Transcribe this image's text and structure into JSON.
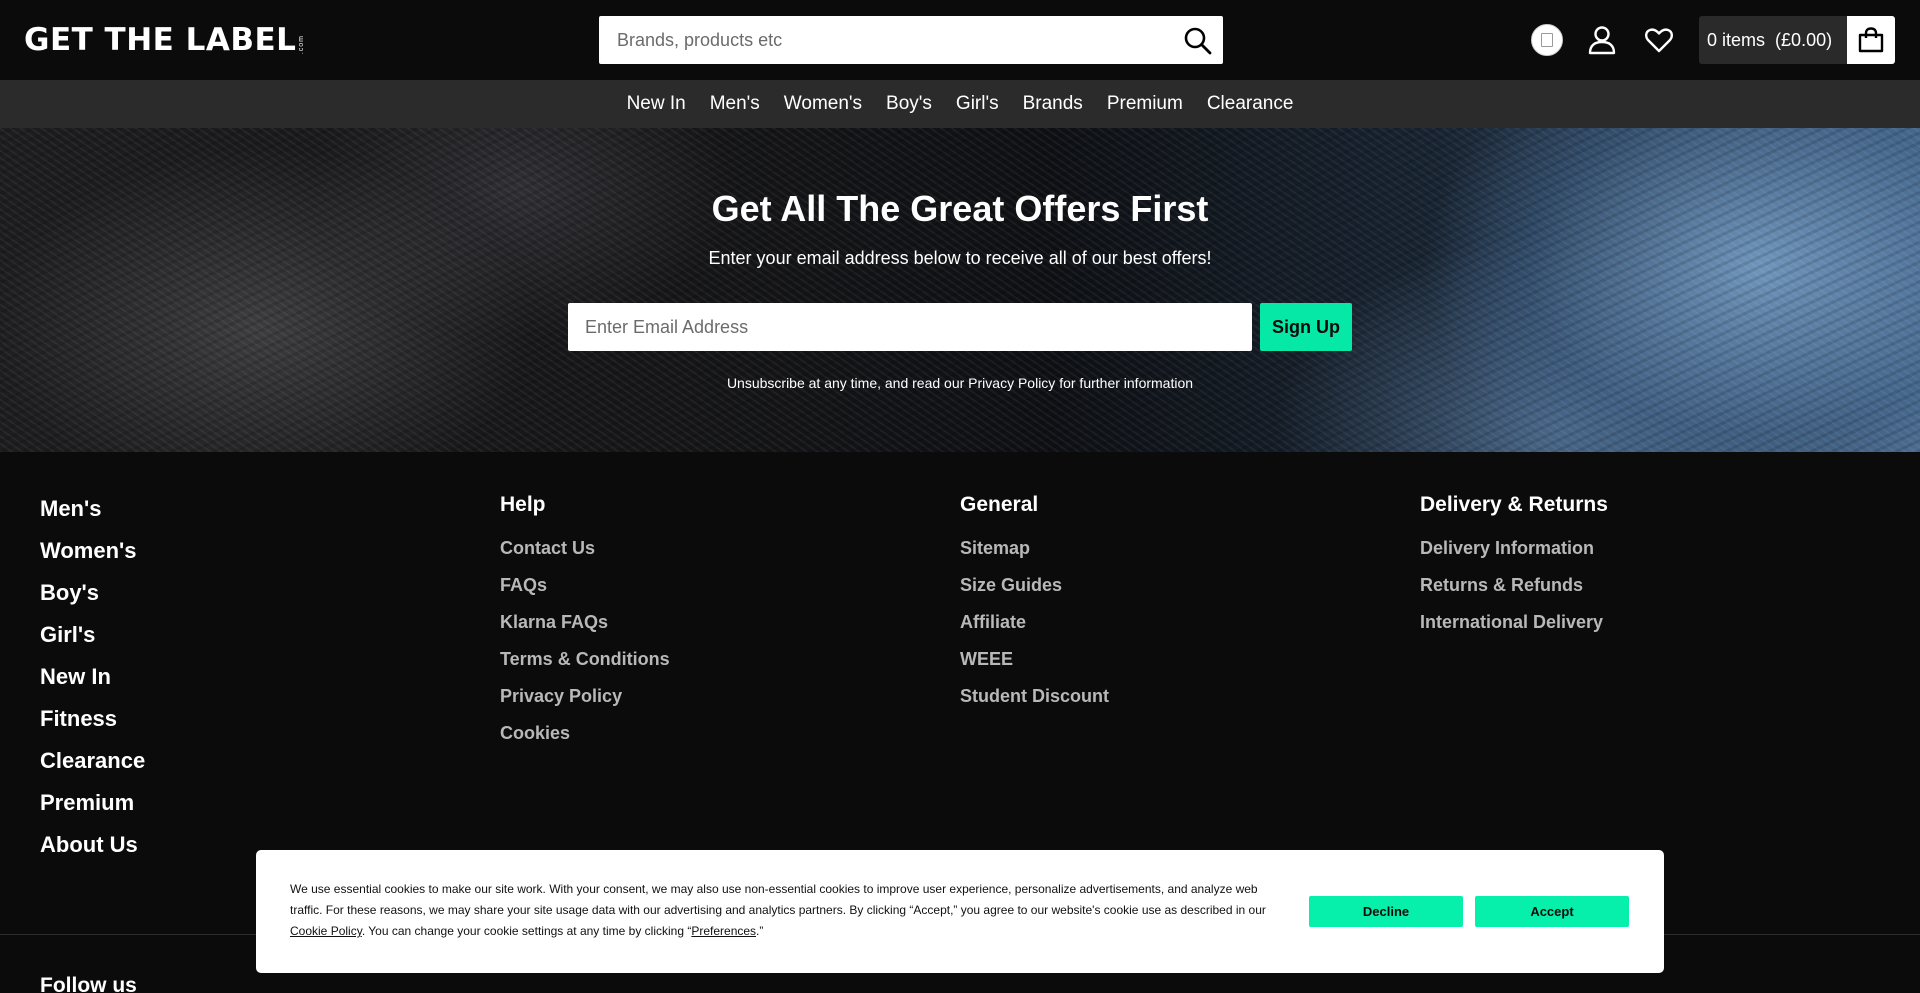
{
  "header": {
    "logo_text": "GET THE LABEL",
    "logo_suffix": ".com",
    "search_placeholder": "Brands, products etc",
    "basket_label": "0 items",
    "basket_total": "(£0.00)"
  },
  "nav": {
    "items": [
      "New In",
      "Men's",
      "Women's",
      "Boy's",
      "Girl's",
      "Brands",
      "Premium",
      "Clearance"
    ]
  },
  "newsletter": {
    "title": "Get All The Great Offers First",
    "subtitle": "Enter your email address below to receive all of our best offers!",
    "email_placeholder": "Enter Email Address",
    "signup_label": "Sign Up",
    "note": "Unsubscribe at any time, and read our Privacy Policy for further information"
  },
  "footer": {
    "categories": [
      "Men's",
      "Women's",
      "Boy's",
      "Girl's",
      "New In",
      "Fitness",
      "Clearance",
      "Premium",
      "About Us"
    ],
    "help": {
      "title": "Help",
      "links": [
        "Contact Us",
        "FAQs",
        "Klarna FAQs",
        "Terms & Conditions",
        "Privacy Policy",
        "Cookies"
      ]
    },
    "general": {
      "title": "General",
      "links": [
        "Sitemap",
        "Size Guides",
        "Affiliate",
        "WEEE",
        "Student Discount"
      ]
    },
    "delivery": {
      "title": "Delivery & Returns",
      "links": [
        "Delivery Information",
        "Returns & Refunds",
        "International Delivery"
      ]
    },
    "follow_title": "Follow us"
  },
  "cookie_banner": {
    "text_before": "We use essential cookies to make our site work. With your consent, we may also use non-essential cookies to improve user experience, personalize advertisements, and analyze web traffic. For these reasons, we may share your site usage data with our advertising and analytics partners. By clicking “Accept,” you agree to our website's cookie use as described in our ",
    "cookie_policy_link": "Cookie Policy",
    "text_middle": ". You can change your cookie settings at any time by clicking “",
    "preferences_link": "Preferences",
    "text_after": ".”",
    "decline_label": "Decline",
    "accept_label": "Accept"
  },
  "colors": {
    "accent": "#06e8a6",
    "background": "#0b0b0b",
    "nav_background": "#2b2b2b"
  },
  "icons": {
    "search": "search-icon",
    "flag": "country-flag-icon",
    "account": "user-icon",
    "wishlist": "heart-icon",
    "basket": "shopping-bag-icon"
  }
}
